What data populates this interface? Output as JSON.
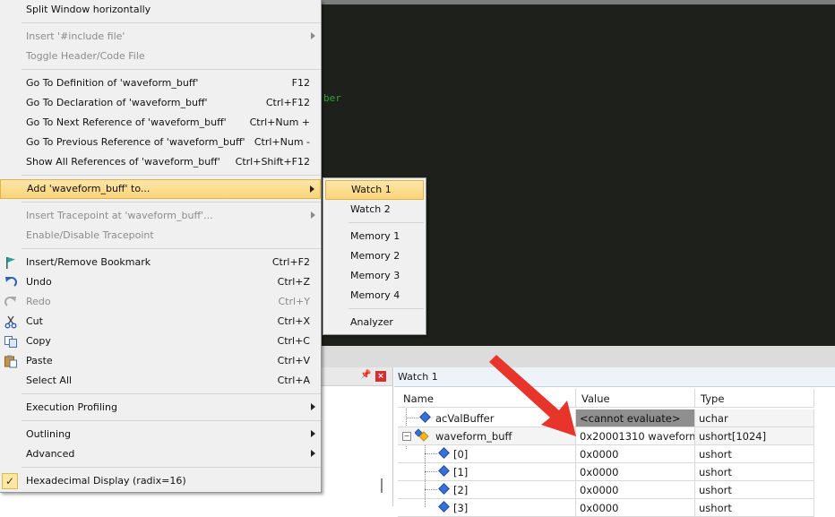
{
  "editor": {
    "code_fragment": "ber"
  },
  "context_menu": {
    "items": [
      {
        "label": "Split Window horizontally"
      },
      {
        "label": "Insert '#include file'"
      },
      {
        "label": "Toggle Header/Code File"
      },
      {
        "label": "Go To Definition of 'waveform_buff'",
        "shortcut": "F12"
      },
      {
        "label": "Go To Declaration of 'waveform_buff'",
        "shortcut": "Ctrl+F12"
      },
      {
        "label": "Go To Next Reference of 'waveform_buff'",
        "shortcut": "Ctrl+Num +"
      },
      {
        "label": "Go To Previous Reference of 'waveform_buff'",
        "shortcut": "Ctrl+Num -"
      },
      {
        "label": "Show All References of 'waveform_buff'",
        "shortcut": "Ctrl+Shift+F12"
      },
      {
        "label": "Add 'waveform_buff' to..."
      },
      {
        "label": "Insert Tracepoint at 'waveform_buff'..."
      },
      {
        "label": "Enable/Disable Tracepoint"
      },
      {
        "label": "Insert/Remove Bookmark",
        "shortcut": "Ctrl+F2",
        "icon": "bookmark-flag-icon"
      },
      {
        "label": "Undo",
        "shortcut": "Ctrl+Z",
        "icon": "undo-icon"
      },
      {
        "label": "Redo",
        "shortcut": "Ctrl+Y",
        "icon": "redo-icon"
      },
      {
        "label": "Cut",
        "shortcut": "Ctrl+X",
        "icon": "scissors-icon"
      },
      {
        "label": "Copy",
        "shortcut": "Ctrl+C",
        "icon": "copy-icon"
      },
      {
        "label": "Paste",
        "shortcut": "Ctrl+V",
        "icon": "paste-icon"
      },
      {
        "label": "Select All",
        "shortcut": "Ctrl+A"
      },
      {
        "label": "Execution Profiling"
      },
      {
        "label": "Outlining"
      },
      {
        "label": "Advanced"
      },
      {
        "label": "Hexadecimal Display (radix=16)",
        "checked": true,
        "icon": "checkmark-icon"
      }
    ]
  },
  "submenu": {
    "items": [
      {
        "label": "Watch 1"
      },
      {
        "label": "Watch 2"
      },
      {
        "label": "Memory 1"
      },
      {
        "label": "Memory 2"
      },
      {
        "label": "Memory 3"
      },
      {
        "label": "Memory 4"
      },
      {
        "label": "Analyzer"
      }
    ]
  },
  "left_panel": {
    "pin_glyph": "📌",
    "close_glyph": "×"
  },
  "watch_panel": {
    "title": "Watch 1",
    "columns": {
      "name": "Name",
      "value": "Value",
      "type": "Type"
    },
    "rows": [
      {
        "name": "acValBuffer",
        "value": "<cannot evaluate>",
        "type": "uchar"
      },
      {
        "name": "waveform_buff",
        "value": "0x20001310 waveform...",
        "type": "ushort[1024]"
      },
      {
        "name": "[0]",
        "value": "0x0000",
        "type": "ushort"
      },
      {
        "name": "[1]",
        "value": "0x0000",
        "type": "ushort"
      },
      {
        "name": "[2]",
        "value": "0x0000",
        "type": "ushort"
      },
      {
        "name": "[3]",
        "value": "0x0000",
        "type": "ushort"
      }
    ]
  },
  "colors": {
    "editor_bg": "#1e211b",
    "menu_bg": "#f0f0f0",
    "highlight": "#fbd479",
    "annotation_arrow": "#e8352b",
    "cannot_eval_bg": "#8f8f8f"
  }
}
